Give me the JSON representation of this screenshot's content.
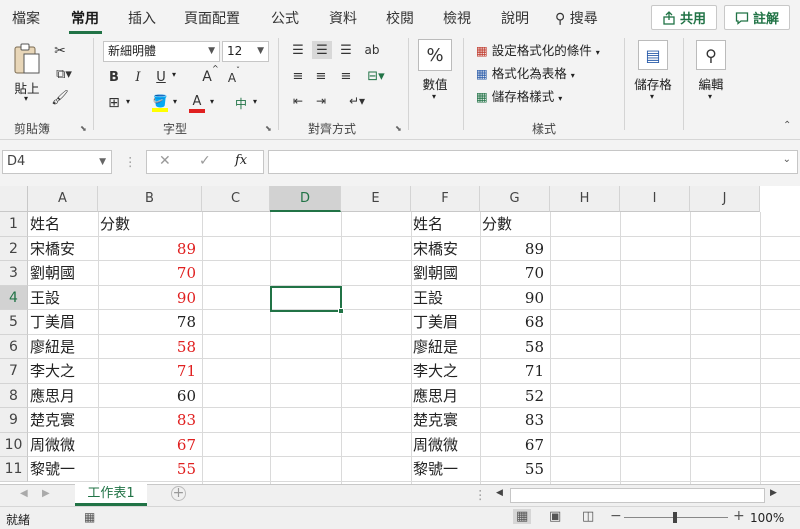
{
  "menu": {
    "tabs": [
      "檔案",
      "常用",
      "插入",
      "頁面配置",
      "公式",
      "資料",
      "校閱",
      "檢視",
      "說明"
    ],
    "search_label": "搜尋",
    "share_label": "共用",
    "comment_label": "註解"
  },
  "ribbon": {
    "clipboard": {
      "paste_label": "貼上",
      "group_label": "剪貼簿"
    },
    "font": {
      "font_name": "新細明體",
      "font_size": "12",
      "bold": "B",
      "italic": "I",
      "underline": "U",
      "grow": "A",
      "shrink": "A",
      "phonetic": "中",
      "group_label": "字型"
    },
    "alignment": {
      "group_label": "對齊方式"
    },
    "number": {
      "label": "數值",
      "symbol": "%"
    },
    "styles": {
      "conditional": "設定格式化的條件",
      "format_table": "格式化為表格",
      "cell_styles": "儲存格樣式",
      "group_label": "樣式"
    },
    "cells": {
      "label": "儲存格"
    },
    "editing": {
      "label": "編輯"
    }
  },
  "formula_bar": {
    "name_box": "D4",
    "cancel": "✕",
    "enter": "✓",
    "fx": "fx",
    "value": ""
  },
  "grid": {
    "columns": [
      "A",
      "B",
      "C",
      "D",
      "E",
      "F",
      "G",
      "H",
      "I",
      "J"
    ],
    "selected_column": "D",
    "selected_row": "4",
    "rows": [
      "1",
      "2",
      "3",
      "4",
      "5",
      "6",
      "7",
      "8",
      "9",
      "10",
      "11"
    ],
    "left_table": {
      "headers": [
        "姓名",
        "分數"
      ],
      "data": [
        {
          "name": "宋橋安",
          "score": "89",
          "highlight": true
        },
        {
          "name": "劉朝國",
          "score": "70",
          "highlight": true
        },
        {
          "name": "王設",
          "score": "90",
          "highlight": true
        },
        {
          "name": "丁美眉",
          "score": "78",
          "highlight": false
        },
        {
          "name": "廖紐是",
          "score": "58",
          "highlight": true
        },
        {
          "name": "李大之",
          "score": "71",
          "highlight": true
        },
        {
          "name": "應思月",
          "score": "60",
          "highlight": false
        },
        {
          "name": "楚克寰",
          "score": "83",
          "highlight": true
        },
        {
          "name": "周微微",
          "score": "67",
          "highlight": true
        },
        {
          "name": "黎號一",
          "score": "55",
          "highlight": true
        }
      ]
    },
    "right_table": {
      "headers": [
        "姓名",
        "分數"
      ],
      "data": [
        {
          "name": "宋橋安",
          "score": "89"
        },
        {
          "name": "劉朝國",
          "score": "70"
        },
        {
          "name": "王設",
          "score": "90"
        },
        {
          "name": "丁美眉",
          "score": "68"
        },
        {
          "name": "廖紐是",
          "score": "58"
        },
        {
          "name": "李大之",
          "score": "71"
        },
        {
          "name": "應思月",
          "score": "52"
        },
        {
          "name": "楚克寰",
          "score": "83"
        },
        {
          "name": "周微微",
          "score": "67"
        },
        {
          "name": "黎號一",
          "score": "55"
        }
      ]
    },
    "highlight_color": "#e02020"
  },
  "sheets": {
    "active": "工作表1",
    "add": "+"
  },
  "status": {
    "ready": "就緒",
    "zoom": "100%"
  },
  "colors": {
    "accent": "#217346"
  }
}
